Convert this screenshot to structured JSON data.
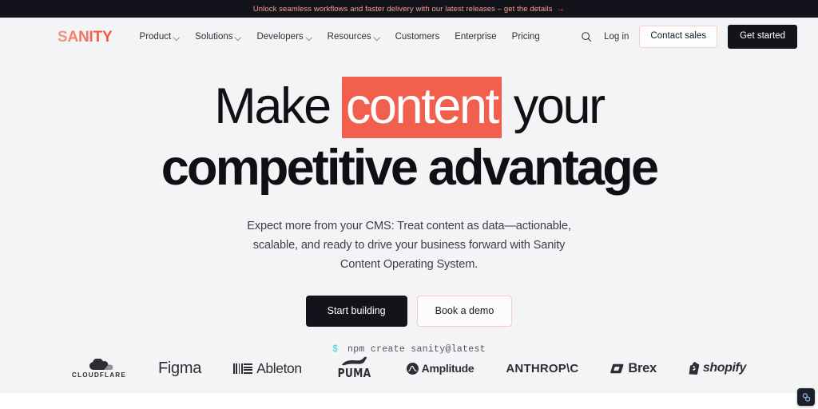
{
  "banner": {
    "text": "Unlock seamless workflows and faster delivery with our latest releases – get the details",
    "arrow": "→"
  },
  "nav": {
    "logo": "SANITY",
    "logo_letters": [
      "S",
      "A",
      "N",
      "I",
      "T",
      "Y"
    ],
    "items": [
      {
        "label": "Product",
        "has_caret": true
      },
      {
        "label": "Solutions",
        "has_caret": true
      },
      {
        "label": "Developers",
        "has_caret": true
      },
      {
        "label": "Resources",
        "has_caret": true
      },
      {
        "label": "Customers",
        "has_caret": false
      },
      {
        "label": "Enterprise",
        "has_caret": false
      },
      {
        "label": "Pricing",
        "has_caret": false
      }
    ],
    "search_icon": "search-icon",
    "login": "Log in",
    "contact_sales": "Contact sales",
    "get_started": "Get started"
  },
  "hero": {
    "headline_line1_pre": "Make ",
    "headline_highlight": "content",
    "headline_line1_post": " your",
    "headline_line2": "competitive advantage",
    "subtitle": "Expect more from your CMS: Treat content as data—actionable, scalable, and ready to drive your business forward with Sanity Content Operating System.",
    "cta_primary": "Start building",
    "cta_secondary": "Book a demo",
    "npm_prompt": "$",
    "npm_command": "npm create sanity@latest"
  },
  "logos": [
    {
      "name": "Cloudflare",
      "wordmark": "CLOUDFLARE"
    },
    {
      "name": "Figma",
      "wordmark": "Figma"
    },
    {
      "name": "Ableton",
      "wordmark": "Ableton"
    },
    {
      "name": "Puma",
      "wordmark": "PUMA"
    },
    {
      "name": "Amplitude",
      "wordmark": "Amplitude"
    },
    {
      "name": "Anthropic",
      "wordmark": "ANTHROP\\C"
    },
    {
      "name": "Brex",
      "wordmark": "Brex"
    },
    {
      "name": "Shopify",
      "wordmark": "shopify"
    }
  ],
  "widget": {
    "icon": "link-chain-icon"
  },
  "colors": {
    "accent": "#f1583f",
    "highlight": "#f1604d",
    "dark": "#13141b",
    "hero_bg": "#f4f4f6",
    "banner_bg": "#13141b",
    "terminal_prompt": "#3fd1cd"
  }
}
